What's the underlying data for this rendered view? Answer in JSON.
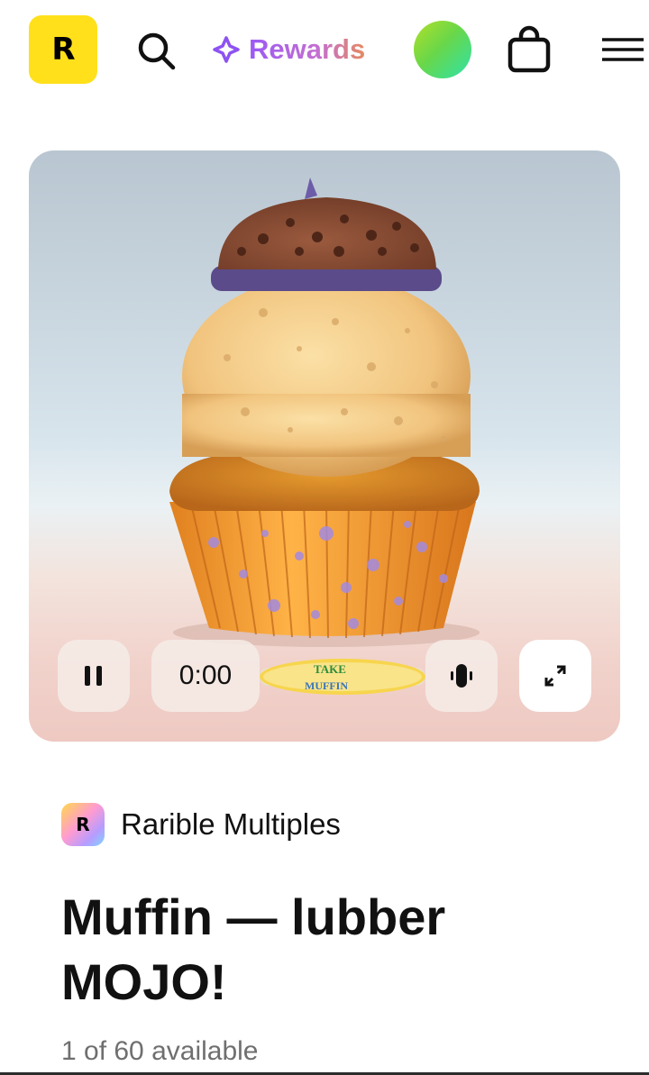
{
  "header": {
    "logo_letter": "R",
    "rewards_label": "Rewards",
    "icons": [
      "search-icon",
      "sparkle-icon",
      "avatar",
      "bag-icon",
      "menu-icon"
    ],
    "colors": {
      "logo_bg": "#ffe01a",
      "rewards_gradient_start": "#9b59f5",
      "rewards_gradient_end": "#e58a60"
    }
  },
  "player": {
    "time": "0:00",
    "progress_fraction": 0,
    "progress_thumb_text": [
      "TAKE",
      "MUFFIN"
    ],
    "icons": [
      "pause-icon",
      "volume-icon",
      "expand-icon"
    ]
  },
  "item": {
    "collection_logo_letter": "R",
    "collection_name": "Rarible Multiples",
    "title": "Muffin — lubber MOJO!",
    "availability": "1 of 60 available"
  }
}
